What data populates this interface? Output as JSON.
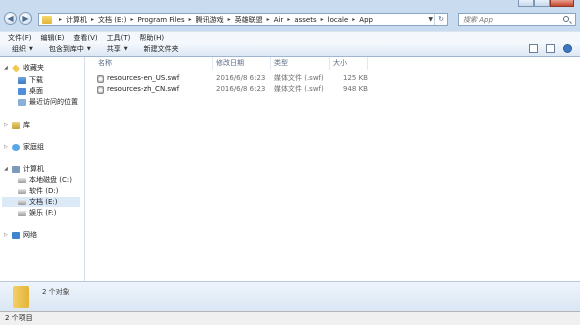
{
  "address": {
    "crumbs": [
      "计算机",
      "文档 (E:)",
      "Program Files",
      "腾讯游戏",
      "英雄联盟",
      "Air",
      "assets",
      "locale",
      "App"
    ]
  },
  "search": {
    "placeholder": "搜索 App"
  },
  "menu": {
    "items": [
      "文件(F)",
      "编辑(E)",
      "查看(V)",
      "工具(T)",
      "帮助(H)"
    ]
  },
  "toolbar": {
    "organize": "组织",
    "include_library": "包含到库中",
    "share": "共享",
    "new_folder": "新建文件夹"
  },
  "sidebar": {
    "favorites": "收藏夹",
    "downloads": "下载",
    "desktop": "桌面",
    "recent": "最近访问的位置",
    "libraries": "库",
    "homegroup": "家庭组",
    "computer": "计算机",
    "drive_c": "本地磁盘 (C:)",
    "drive_d": "软件 (D:)",
    "drive_e": "文档 (E:)",
    "drive_f": "娱乐 (F:)",
    "network": "网络"
  },
  "columns": {
    "name": "名称",
    "modified": "修改日期",
    "type": "类型",
    "size": "大小"
  },
  "files": [
    {
      "name": "resources-en_US.swf",
      "modified": "2016/6/8 6:23",
      "type": "媒体文件 (.swf)",
      "size": "125 KB"
    },
    {
      "name": "resources-zh_CN.swf",
      "modified": "2016/6/8 6:23",
      "type": "媒体文件 (.swf)",
      "size": "948 KB"
    }
  ],
  "details": {
    "count": "2 个对象"
  },
  "status": {
    "count": "2 个项目"
  },
  "icons": {
    "back": "back-arrow-icon",
    "forward": "forward-arrow-icon",
    "folder": "folder-icon",
    "search": "search-icon",
    "file": "swf-file-icon"
  }
}
